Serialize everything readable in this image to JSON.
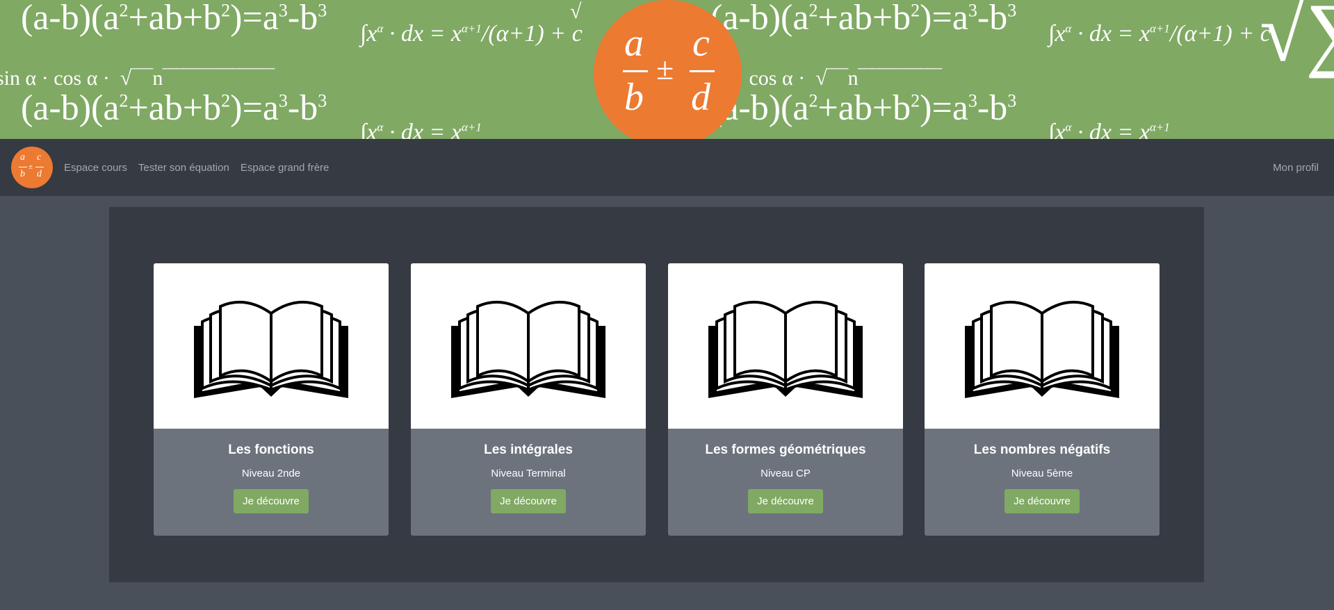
{
  "banner": {
    "logo": {
      "numerator_a": "a",
      "denominator_b": "b",
      "operator": "±",
      "numerator_c": "c",
      "denominator_d": "d"
    }
  },
  "navbar": {
    "logo": {
      "a": "a",
      "b": "b",
      "c": "c",
      "d": "d"
    },
    "links": [
      "Espace cours",
      "Tester son équation",
      "Espace grand frère"
    ],
    "profile": "Mon profil"
  },
  "courses": [
    {
      "title": "Les fonctions",
      "level": "Niveau 2nde",
      "button": "Je découvre"
    },
    {
      "title": "Les intégrales",
      "level": "Niveau Terminal",
      "button": "Je découvre"
    },
    {
      "title": "Les formes géométriques",
      "level": "Niveau CP",
      "button": "Je découvre"
    },
    {
      "title": "Les nombres négatifs",
      "level": "Niveau 5ème",
      "button": "Je découvre"
    }
  ],
  "colors": {
    "banner_green": "#80a964",
    "brand_orange": "#ec7a31",
    "navbar_bg": "#353a43",
    "page_bg": "#495059",
    "card_bg": "#6c737d",
    "button_green": "#80a964"
  },
  "icons": {
    "course_image": "open-book-icon"
  }
}
